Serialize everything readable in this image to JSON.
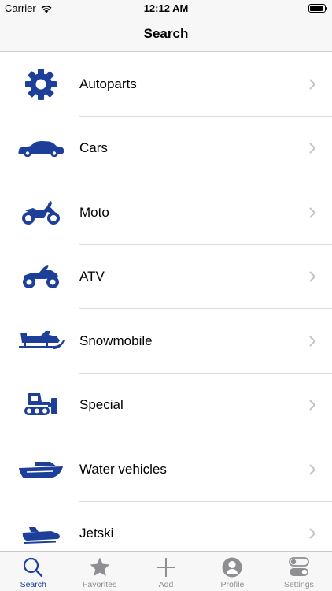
{
  "status_bar": {
    "carrier": "Carrier",
    "time": "12:12 AM"
  },
  "nav": {
    "title": "Search"
  },
  "colors": {
    "accent": "#1d3f9a",
    "inactive": "#8e8e93",
    "chevron": "#c4c4c7"
  },
  "categories": [
    {
      "label": "Autoparts",
      "icon": "gear-icon"
    },
    {
      "label": "Cars",
      "icon": "car-icon"
    },
    {
      "label": "Moto",
      "icon": "motorcycle-icon"
    },
    {
      "label": "ATV",
      "icon": "atv-icon"
    },
    {
      "label": "Snowmobile",
      "icon": "snowmobile-icon"
    },
    {
      "label": "Special",
      "icon": "special-vehicle-icon"
    },
    {
      "label": "Water vehicles",
      "icon": "boat-icon"
    },
    {
      "label": "Jetski",
      "icon": "jetski-icon"
    }
  ],
  "tabs": [
    {
      "label": "Search",
      "icon": "search-icon",
      "active": true
    },
    {
      "label": "Favorites",
      "icon": "star-icon",
      "active": false
    },
    {
      "label": "Add",
      "icon": "plus-icon",
      "active": false
    },
    {
      "label": "Profile",
      "icon": "profile-icon",
      "active": false
    },
    {
      "label": "Settings",
      "icon": "toggle-icon",
      "active": false
    }
  ]
}
